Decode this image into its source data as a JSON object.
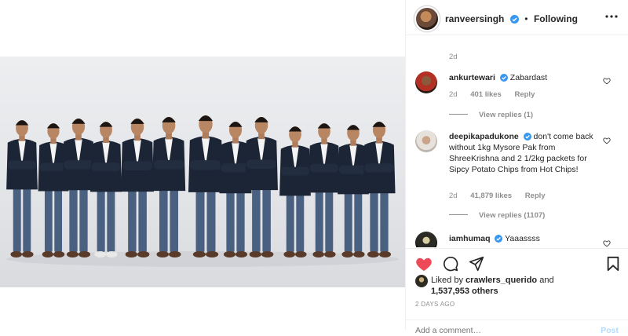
{
  "post": {
    "username": "ranveersingh",
    "follow_status": "Following",
    "photo_description": "group-photo-cricket-team"
  },
  "comments": [
    {
      "id": "caption-end",
      "meta_time": "2d"
    },
    {
      "username": "ankurtewari",
      "text": "Zabardast",
      "time": "2d",
      "likes": "401 likes",
      "reply": "Reply",
      "view_replies": "View replies (1)"
    },
    {
      "username": "deepikapadukone",
      "text": "don't come back without 1kg Mysore Pak from ShreeKrishna and 2 1/2kg packets for Sipcy Potato Chips from Hot Chips!",
      "time": "2d",
      "likes": "41,879 likes",
      "reply": "Reply",
      "view_replies": "View replies (1107)"
    },
    {
      "username": "iamhumaq",
      "text": "Yaaassss"
    }
  ],
  "actions": {
    "liked_by_prefix": "Liked by",
    "liked_by_user": "crawlers_querido",
    "liked_by_and": "and",
    "likes_count": "1,537,953 others",
    "time_ago": "2 DAYS AGO"
  },
  "add_comment": {
    "placeholder": "Add a comment…",
    "post_label": "Post"
  },
  "colors": {
    "like_red": "#ed4956",
    "verified_blue": "#3897f0",
    "blazer_navy": "#1c2536",
    "jeans_blue": "#4a6080"
  }
}
